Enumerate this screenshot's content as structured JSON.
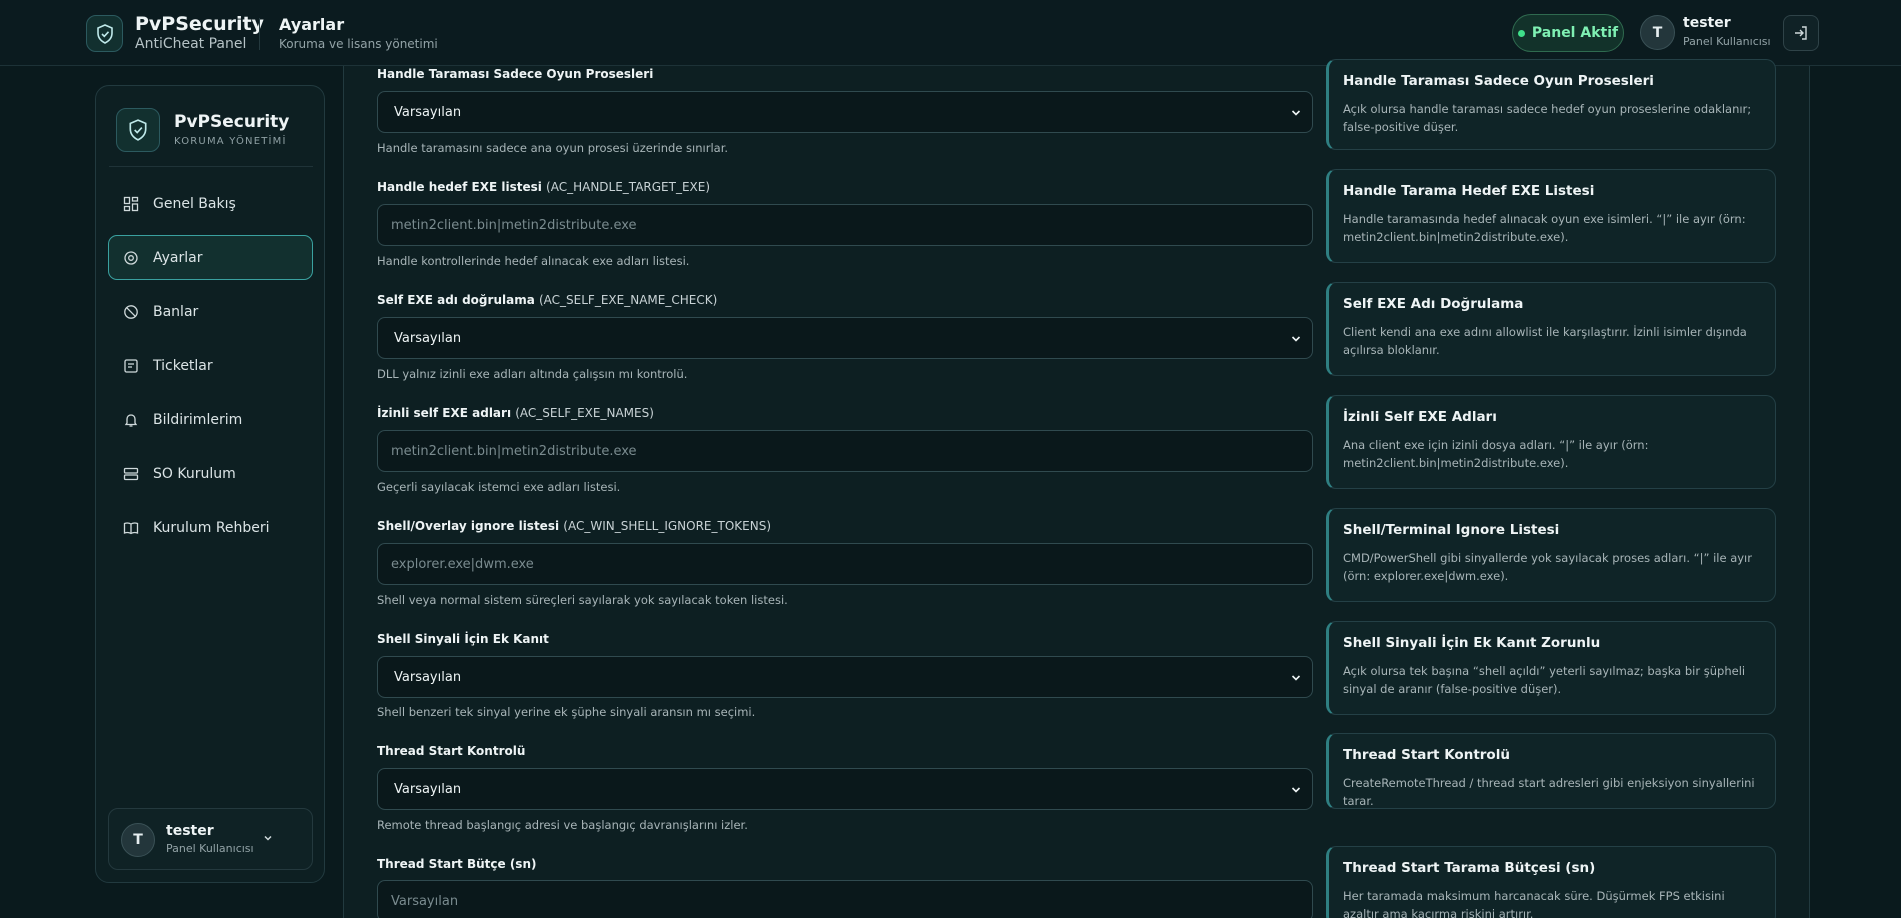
{
  "header": {
    "brand_title": "PvPSecurity",
    "brand_sub": "AntiCheat Panel",
    "page_title": "Ayarlar",
    "page_sub": "Koruma ve lisans yönetimi",
    "status_label": "Panel Aktif",
    "user_initial": "T",
    "user_name": "tester",
    "user_role": "Panel Kullanıcısı"
  },
  "sidebar": {
    "title": "PvPSecurity",
    "subtitle": "KORUMA YÖNETİMİ",
    "items": [
      {
        "label": "Genel Bakış",
        "icon": "grid-icon"
      },
      {
        "label": "Ayarlar",
        "icon": "gear-icon",
        "active": true
      },
      {
        "label": "Banlar",
        "icon": "ban-icon"
      },
      {
        "label": "Ticketlar",
        "icon": "ticket-icon"
      },
      {
        "label": "Bildirimlerim",
        "icon": "bell-icon"
      },
      {
        "label": "SO Kurulum",
        "icon": "server-icon"
      },
      {
        "label": "Kurulum Rehberi",
        "icon": "book-icon"
      }
    ],
    "user_initial": "T",
    "user_name": "tester",
    "user_role": "Panel Kullanıcısı"
  },
  "fields": [
    {
      "label": "Handle Taraması Sadece Oyun Prosesleri",
      "key": "",
      "type": "select",
      "value": "Varsayılan",
      "help": "Handle taramasını sadece ana oyun prosesi üzerinde sınırlar."
    },
    {
      "label": "Handle hedef EXE listesi",
      "key": "(AC_HANDLE_TARGET_EXE)",
      "type": "text",
      "placeholder": "metin2client.bin|metin2distribute.exe",
      "help": "Handle kontrollerinde hedef alınacak exe adları listesi."
    },
    {
      "label": "Self EXE adı doğrulama",
      "key": "(AC_SELF_EXE_NAME_CHECK)",
      "type": "select",
      "value": "Varsayılan",
      "help": "DLL yalnız izinli exe adları altında çalışsın mı kontrolü."
    },
    {
      "label": "İzinli self EXE adları",
      "key": "(AC_SELF_EXE_NAMES)",
      "type": "text",
      "placeholder": "metin2client.bin|metin2distribute.exe",
      "help": "Geçerli sayılacak istemci exe adları listesi."
    },
    {
      "label": "Shell/Overlay ignore listesi",
      "key": "(AC_WIN_SHELL_IGNORE_TOKENS)",
      "type": "text",
      "placeholder": "explorer.exe|dwm.exe",
      "help": "Shell veya normal sistem süreçleri sayılarak yok sayılacak token listesi."
    },
    {
      "label": "Shell Sinyali İçin Ek Kanıt",
      "key": "",
      "type": "select",
      "value": "Varsayılan",
      "help": "Shell benzeri tek sinyal yerine ek şüphe sinyali aransın mı seçimi."
    },
    {
      "label": "Thread Start Kontrolü",
      "key": "",
      "type": "select",
      "value": "Varsayılan",
      "help": "Remote thread başlangıç adresi ve başlangıç davranışlarını izler."
    },
    {
      "label": "Thread Start Bütçe (sn)",
      "key": "",
      "type": "text",
      "placeholder": "Varsayılan",
      "help": ""
    }
  ],
  "info_cards": [
    {
      "title": "Handle Taraması Sadece Oyun Prosesleri",
      "desc": "Açık olursa handle taraması sadece hedef oyun proseslerine odaklanır; false-positive düşer."
    },
    {
      "title": "Handle Tarama Hedef EXE Listesi",
      "desc": "Handle taramasında hedef alınacak oyun exe isimleri. “|” ile ayır (örn: metin2client.bin|metin2distribute.exe)."
    },
    {
      "title": "Self EXE Adı Doğrulama",
      "desc": "Client kendi ana exe adını allowlist ile karşılaştırır. İzinli isimler dışında açılırsa bloklanır."
    },
    {
      "title": "İzinli Self EXE Adları",
      "desc": "Ana client exe için izinli dosya adları. “|” ile ayır (örn: metin2client.bin|metin2distribute.exe)."
    },
    {
      "title": "Shell/Terminal Ignore Listesi",
      "desc": "CMD/PowerShell gibi sinyallerde yok sayılacak proses adları. “|” ile ayır (örn: explorer.exe|dwm.exe)."
    },
    {
      "title": "Shell Sinyali İçin Ek Kanıt Zorunlu",
      "desc": "Açık olursa tek başına “shell açıldı” yeterli sayılmaz; başka bir şüpheli sinyal de aranır (false-positive düşer)."
    },
    {
      "title": "Thread Start Kontrolü",
      "desc": "CreateRemoteThread / thread start adresleri gibi enjeksiyon sinyallerini tarar."
    },
    {
      "title": "Thread Start Tarama Bütçesi (sn)",
      "desc": "Her taramada maksimum harcanacak süre. Düşürmek FPS etkisini azaltır ama kaçırma riskini artırır."
    }
  ]
}
